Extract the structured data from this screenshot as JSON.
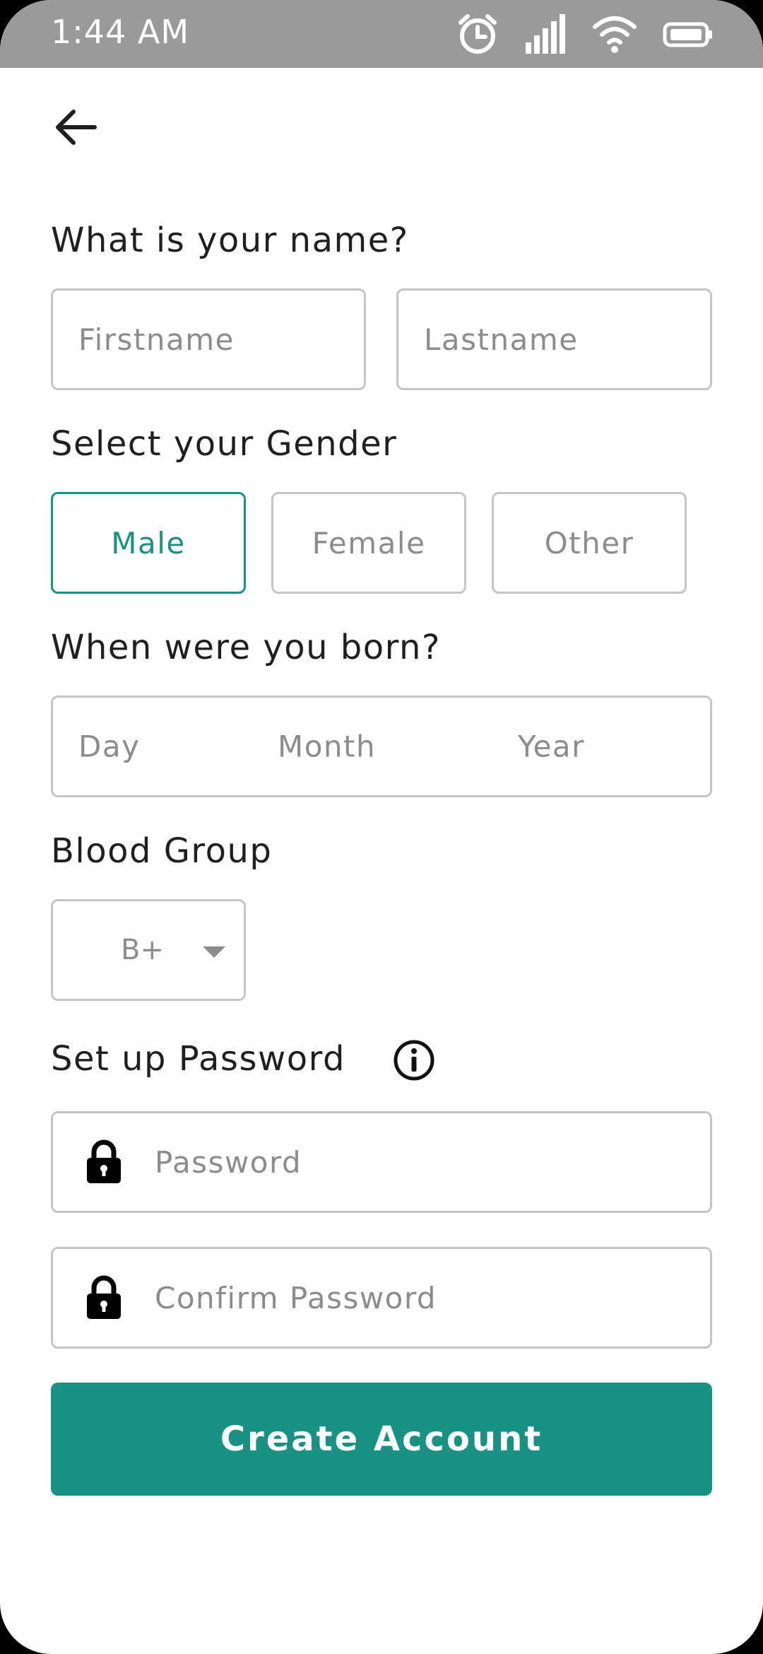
{
  "status_bar": {
    "time": "1:44 AM"
  },
  "name_section": {
    "title": "What is your name?",
    "first_placeholder": "Firstname",
    "last_placeholder": "Lastname"
  },
  "gender_section": {
    "title": "Select your Gender",
    "options": [
      "Male",
      "Female",
      "Other"
    ],
    "selected": "Male"
  },
  "dob_section": {
    "title": "When were you born?",
    "day": "Day",
    "month": "Month",
    "year": "Year"
  },
  "blood_section": {
    "title": "Blood Group",
    "value": "B+"
  },
  "password_section": {
    "title": "Set up Password",
    "password_placeholder": "Password",
    "confirm_placeholder": "Confirm Password"
  },
  "submit": {
    "label": "Create Account"
  },
  "colors": {
    "accent": "#1a9283",
    "status_bar": "#9a9a9a"
  },
  "icons": [
    "alarm-icon",
    "signal-icon",
    "wifi-icon",
    "battery-icon",
    "back-arrow-icon",
    "info-icon",
    "lock-icon",
    "dropdown-icon"
  ]
}
